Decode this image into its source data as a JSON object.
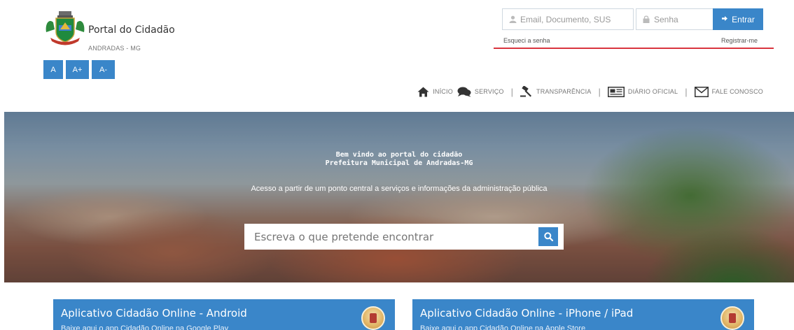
{
  "header": {
    "title": "Portal do Cidadão",
    "subtitle": "ANDRADAS - MG",
    "font_buttons": [
      "A",
      "A+",
      "A-"
    ]
  },
  "login": {
    "email_placeholder": "Email, Documento, SUS",
    "password_placeholder": "Senha",
    "submit_label": "Entrar",
    "forgot_label": "Esqueci a senha",
    "register_label": "Registrar-me"
  },
  "nav": {
    "items": [
      {
        "label": "INÍCIO",
        "icon": "home-icon"
      },
      {
        "label": "SERVIÇO",
        "icon": "chat-icon"
      },
      {
        "label": "TRANSPARÊNCIA",
        "icon": "gavel-icon"
      },
      {
        "label": "DIÁRIO OFICIAL",
        "icon": "newspaper-icon"
      },
      {
        "label": "FALE CONOSCO",
        "icon": "envelope-icon"
      }
    ]
  },
  "hero": {
    "title_line1": "Bem vindo ao portal do cidadão",
    "title_line2": "Prefeitura Municipal de Andradas-MG",
    "subtitle": "Acesso a partir de um ponto central a serviços e informações da administração pública",
    "search_placeholder": "Escreva o que pretende encontrar"
  },
  "cards": [
    {
      "title": "Aplicativo Cidadão Online - Android",
      "description": "Baixe aqui o app Cidadão Online na Google Play"
    },
    {
      "title": "Aplicativo Cidadão Online - iPhone / iPad",
      "description": "Baixe aqui o app Cidadão Online na Apple Store"
    }
  ],
  "colors": {
    "accent": "#3a86c9",
    "divider_red": "#d9343e"
  }
}
